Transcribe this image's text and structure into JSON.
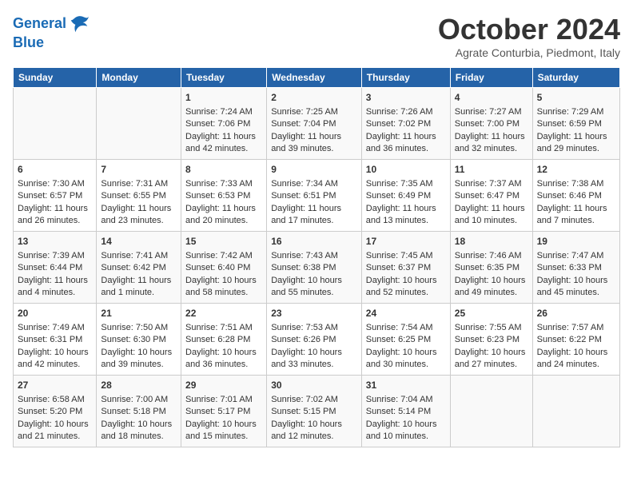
{
  "header": {
    "logo_line1": "General",
    "logo_line2": "Blue",
    "month": "October 2024",
    "location": "Agrate Conturbia, Piedmont, Italy"
  },
  "days_of_week": [
    "Sunday",
    "Monday",
    "Tuesday",
    "Wednesday",
    "Thursday",
    "Friday",
    "Saturday"
  ],
  "weeks": [
    [
      {
        "day": "",
        "data": ""
      },
      {
        "day": "",
        "data": ""
      },
      {
        "day": "1",
        "data": "Sunrise: 7:24 AM\nSunset: 7:06 PM\nDaylight: 11 hours and 42 minutes."
      },
      {
        "day": "2",
        "data": "Sunrise: 7:25 AM\nSunset: 7:04 PM\nDaylight: 11 hours and 39 minutes."
      },
      {
        "day": "3",
        "data": "Sunrise: 7:26 AM\nSunset: 7:02 PM\nDaylight: 11 hours and 36 minutes."
      },
      {
        "day": "4",
        "data": "Sunrise: 7:27 AM\nSunset: 7:00 PM\nDaylight: 11 hours and 32 minutes."
      },
      {
        "day": "5",
        "data": "Sunrise: 7:29 AM\nSunset: 6:59 PM\nDaylight: 11 hours and 29 minutes."
      }
    ],
    [
      {
        "day": "6",
        "data": "Sunrise: 7:30 AM\nSunset: 6:57 PM\nDaylight: 11 hours and 26 minutes."
      },
      {
        "day": "7",
        "data": "Sunrise: 7:31 AM\nSunset: 6:55 PM\nDaylight: 11 hours and 23 minutes."
      },
      {
        "day": "8",
        "data": "Sunrise: 7:33 AM\nSunset: 6:53 PM\nDaylight: 11 hours and 20 minutes."
      },
      {
        "day": "9",
        "data": "Sunrise: 7:34 AM\nSunset: 6:51 PM\nDaylight: 11 hours and 17 minutes."
      },
      {
        "day": "10",
        "data": "Sunrise: 7:35 AM\nSunset: 6:49 PM\nDaylight: 11 hours and 13 minutes."
      },
      {
        "day": "11",
        "data": "Sunrise: 7:37 AM\nSunset: 6:47 PM\nDaylight: 11 hours and 10 minutes."
      },
      {
        "day": "12",
        "data": "Sunrise: 7:38 AM\nSunset: 6:46 PM\nDaylight: 11 hours and 7 minutes."
      }
    ],
    [
      {
        "day": "13",
        "data": "Sunrise: 7:39 AM\nSunset: 6:44 PM\nDaylight: 11 hours and 4 minutes."
      },
      {
        "day": "14",
        "data": "Sunrise: 7:41 AM\nSunset: 6:42 PM\nDaylight: 11 hours and 1 minute."
      },
      {
        "day": "15",
        "data": "Sunrise: 7:42 AM\nSunset: 6:40 PM\nDaylight: 10 hours and 58 minutes."
      },
      {
        "day": "16",
        "data": "Sunrise: 7:43 AM\nSunset: 6:38 PM\nDaylight: 10 hours and 55 minutes."
      },
      {
        "day": "17",
        "data": "Sunrise: 7:45 AM\nSunset: 6:37 PM\nDaylight: 10 hours and 52 minutes."
      },
      {
        "day": "18",
        "data": "Sunrise: 7:46 AM\nSunset: 6:35 PM\nDaylight: 10 hours and 49 minutes."
      },
      {
        "day": "19",
        "data": "Sunrise: 7:47 AM\nSunset: 6:33 PM\nDaylight: 10 hours and 45 minutes."
      }
    ],
    [
      {
        "day": "20",
        "data": "Sunrise: 7:49 AM\nSunset: 6:31 PM\nDaylight: 10 hours and 42 minutes."
      },
      {
        "day": "21",
        "data": "Sunrise: 7:50 AM\nSunset: 6:30 PM\nDaylight: 10 hours and 39 minutes."
      },
      {
        "day": "22",
        "data": "Sunrise: 7:51 AM\nSunset: 6:28 PM\nDaylight: 10 hours and 36 minutes."
      },
      {
        "day": "23",
        "data": "Sunrise: 7:53 AM\nSunset: 6:26 PM\nDaylight: 10 hours and 33 minutes."
      },
      {
        "day": "24",
        "data": "Sunrise: 7:54 AM\nSunset: 6:25 PM\nDaylight: 10 hours and 30 minutes."
      },
      {
        "day": "25",
        "data": "Sunrise: 7:55 AM\nSunset: 6:23 PM\nDaylight: 10 hours and 27 minutes."
      },
      {
        "day": "26",
        "data": "Sunrise: 7:57 AM\nSunset: 6:22 PM\nDaylight: 10 hours and 24 minutes."
      }
    ],
    [
      {
        "day": "27",
        "data": "Sunrise: 6:58 AM\nSunset: 5:20 PM\nDaylight: 10 hours and 21 minutes."
      },
      {
        "day": "28",
        "data": "Sunrise: 7:00 AM\nSunset: 5:18 PM\nDaylight: 10 hours and 18 minutes."
      },
      {
        "day": "29",
        "data": "Sunrise: 7:01 AM\nSunset: 5:17 PM\nDaylight: 10 hours and 15 minutes."
      },
      {
        "day": "30",
        "data": "Sunrise: 7:02 AM\nSunset: 5:15 PM\nDaylight: 10 hours and 12 minutes."
      },
      {
        "day": "31",
        "data": "Sunrise: 7:04 AM\nSunset: 5:14 PM\nDaylight: 10 hours and 10 minutes."
      },
      {
        "day": "",
        "data": ""
      },
      {
        "day": "",
        "data": ""
      }
    ]
  ]
}
